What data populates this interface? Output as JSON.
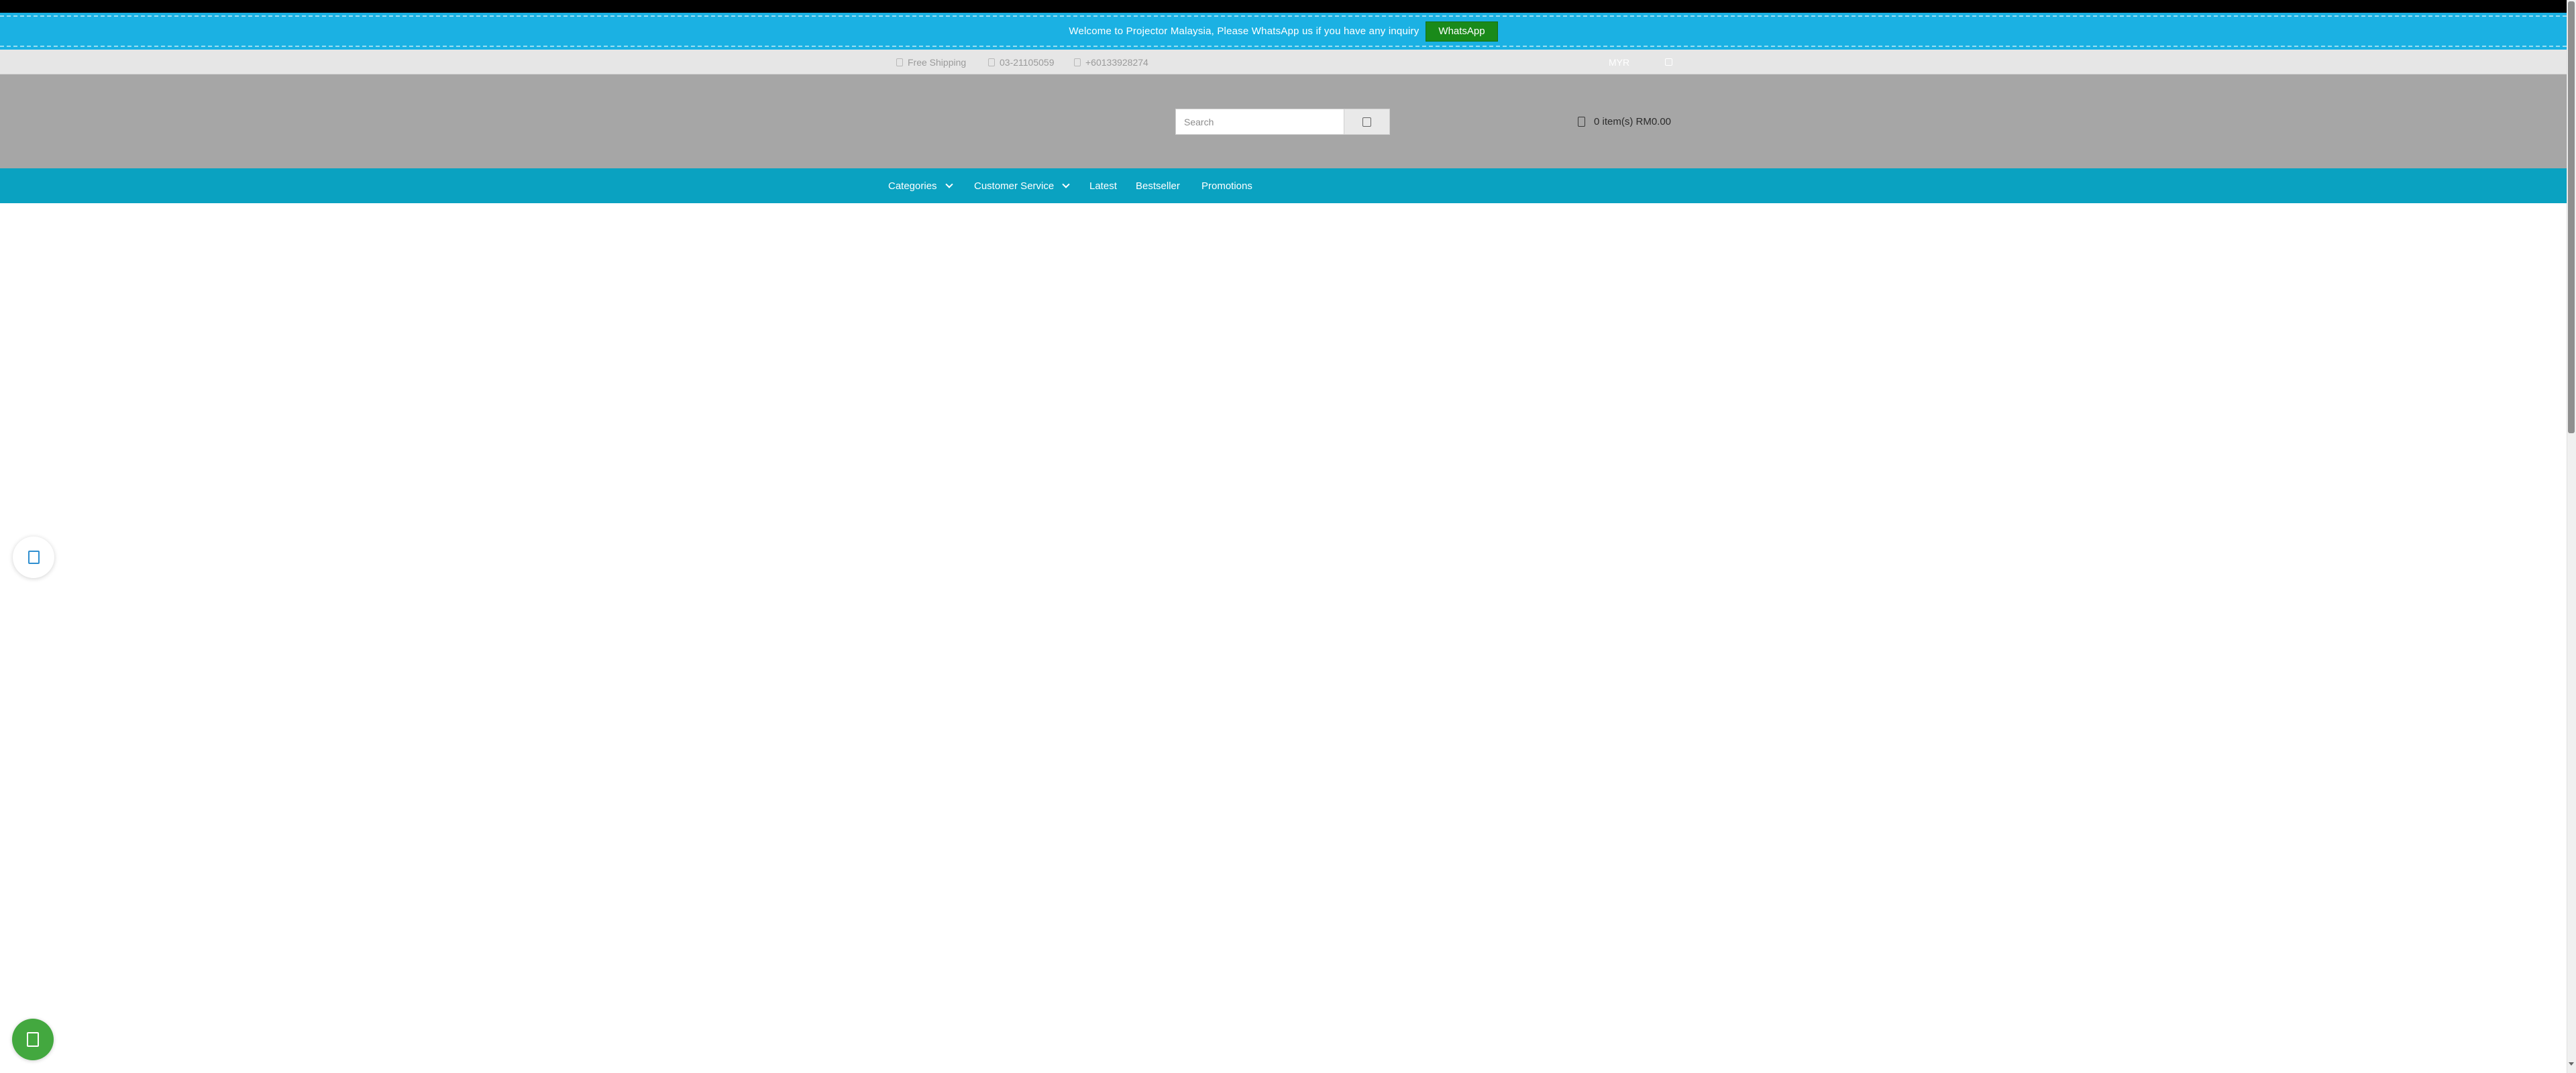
{
  "announcement": {
    "text": "Welcome to Projector Malaysia, Please WhatsApp us if you have any inquiry",
    "button_label": "WhatsApp"
  },
  "info_bar": {
    "shipping": "Free Shipping",
    "phone": "03-21105059",
    "mobile": "+60133928274",
    "currency": "MYR"
  },
  "header": {
    "search_placeholder": "Search",
    "cart_label": "0 item(s) RM0.00"
  },
  "nav": {
    "categories": "Categories",
    "customer_service": "Customer Service",
    "latest": "Latest",
    "bestseller": "Bestseller",
    "promotions": "Promotions"
  },
  "colors": {
    "announcement_bg": "#1bb1e3",
    "whatsapp_button": "#1a8a1a",
    "nav_bg": "#0aa2c1",
    "header_bg": "#a6a6a6",
    "float_whatsapp": "#43a83f"
  },
  "icons": {
    "shipping": "truck-icon",
    "phone": "phone-icon",
    "mobile": "whatsapp-icon",
    "language": "globe-icon",
    "search": "search-icon",
    "cart": "cart-icon",
    "float_left": "chat-icon",
    "float_whatsapp": "whatsapp-icon"
  }
}
